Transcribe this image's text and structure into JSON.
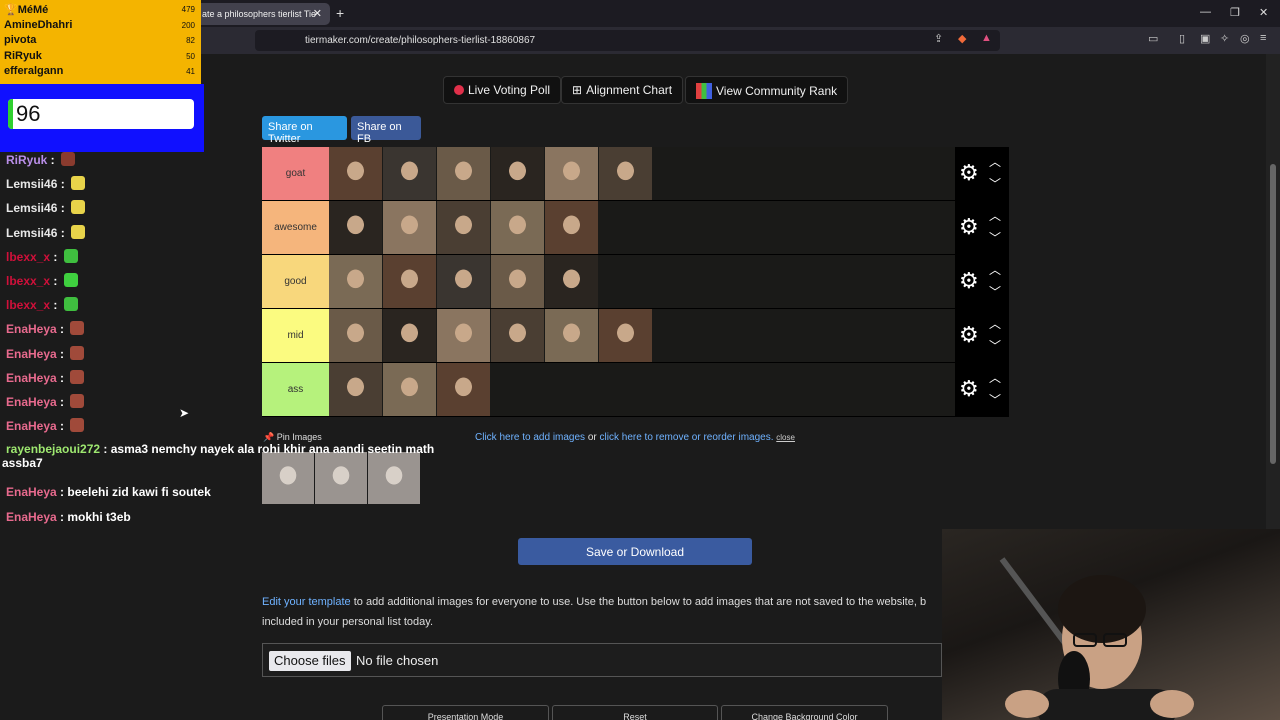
{
  "browser": {
    "tab_title": "ate a philosophers tierlist Tie",
    "tab_close": "✕",
    "new_tab": "+",
    "url": "tiermaker.com/create/philosophers-tierlist-18860867",
    "window_controls": [
      "—",
      "❐",
      "✕"
    ]
  },
  "toolbar": {
    "live_voting": "Live Voting Poll",
    "alignment_chart": "Alignment Chart",
    "community_rank": "View Community Rank",
    "share_twitter": "Share on Twitter",
    "share_fb": "Share on FB"
  },
  "tiers": [
    {
      "label": "goat",
      "color": "#f08080",
      "count": 6
    },
    {
      "label": "awesome",
      "color": "#f5b57c",
      "count": 5
    },
    {
      "label": "good",
      "color": "#f8d77c",
      "count": 5
    },
    {
      "label": "mid",
      "color": "#fbfb80",
      "count": 6
    },
    {
      "label": "ass",
      "color": "#b6f27c",
      "count": 3
    }
  ],
  "pin": {
    "label": "Pin Images",
    "count": 3
  },
  "add_images": {
    "add_link": "Click here to add images",
    "or": "or",
    "remove_link": "click here to remove or reorder images.",
    "close": "close"
  },
  "save_button": "Save or Download",
  "edit_template": {
    "link": "Edit your template",
    "text": "to add additional images for everyone to use. Use the button below to add images that are not saved to the website, b",
    "text2": "included in your personal list today."
  },
  "file_input": {
    "button": "Choose files",
    "status": "No file chosen"
  },
  "bottom_buttons": [
    "Presentation Mode",
    "Reset",
    "Change Background Color"
  ],
  "leaderboard": [
    {
      "name": "MéMé",
      "score": "479"
    },
    {
      "name": "AmineDhahri",
      "score": "200"
    },
    {
      "name": "pivota",
      "score": "82"
    },
    {
      "name": "RiRyuk",
      "score": "50"
    },
    {
      "name": "efferalgann",
      "score": "41"
    }
  ],
  "counter_value": "96",
  "chat": [
    {
      "user": "RiRyuk",
      "text": "",
      "color": "#b98ee8",
      "emote": "#8a3b2e"
    },
    {
      "user": "Lemsii46",
      "text": "",
      "color": "#e8e8e8",
      "emote": "#e8d34a"
    },
    {
      "user": "Lemsii46",
      "text": "",
      "color": "#e8e8e8",
      "emote": "#e8d34a"
    },
    {
      "user": "Lemsii46",
      "text": "",
      "color": "#e8e8e8",
      "emote": "#e8d34a"
    },
    {
      "user": "lbexx_x",
      "text": "",
      "color": "#d0103a",
      "emote": "#3fbf3f"
    },
    {
      "user": "lbexx_x",
      "text": "",
      "color": "#d0103a",
      "emote": "#3fd03f"
    },
    {
      "user": "lbexx_x",
      "text": "",
      "color": "#d0103a",
      "emote": "#3fbf3f"
    },
    {
      "user": "EnaHeya",
      "text": "",
      "color": "#e86a8e",
      "emote": "#a04a3a"
    },
    {
      "user": "EnaHeya",
      "text": "",
      "color": "#e86a8e",
      "emote": "#a04a3a"
    },
    {
      "user": "EnaHeya",
      "text": "",
      "color": "#e86a8e",
      "emote": "#a04a3a"
    },
    {
      "user": "EnaHeya",
      "text": "",
      "color": "#e86a8e",
      "emote": "#a04a3a"
    },
    {
      "user": "EnaHeya",
      "text": "",
      "color": "#e86a8e",
      "emote": "#a04a3a"
    },
    {
      "user": "rayenbejaoui272",
      "text": "asma3 nemchy nayek ala rohi khir ana aandi seetin math",
      "text2": "assba7",
      "color": "#9ee870",
      "emote": ""
    },
    {
      "user": "EnaHeya",
      "text": "beelehi zid kawi fi soutek",
      "color": "#e86a8e",
      "emote": ""
    },
    {
      "user": "EnaHeya",
      "text": "mokhi t3eb",
      "color": "#e86a8e",
      "emote": ""
    }
  ]
}
